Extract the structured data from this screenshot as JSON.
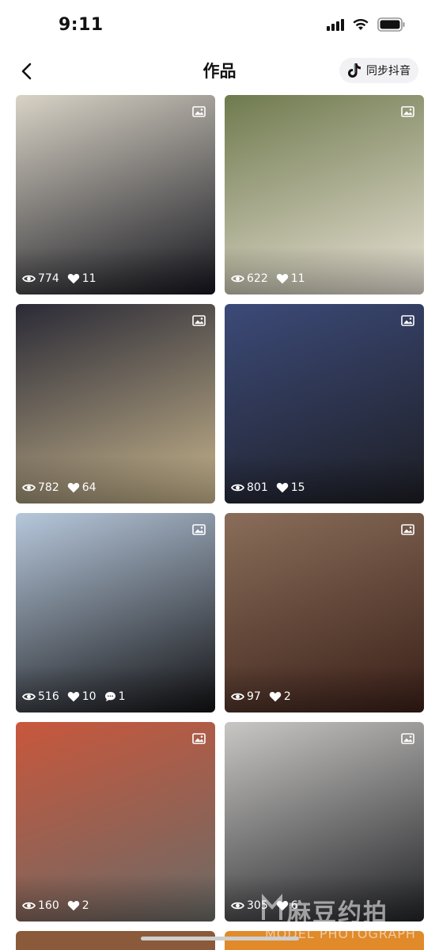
{
  "status_bar": {
    "time": "9:11",
    "signal_icon": "cellular-signal-icon",
    "wifi_icon": "wifi-icon",
    "battery_icon": "battery-icon"
  },
  "nav": {
    "back_icon": "chevron-left-icon",
    "title": "作品",
    "sync_button_label": "同步抖音",
    "sync_icon": "tiktok-logo-icon"
  },
  "posts": [
    {
      "views": "774",
      "likes": "11",
      "comments": null,
      "colors": [
        "#d9d3c6",
        "#15161e"
      ]
    },
    {
      "views": "622",
      "likes": "11",
      "comments": null,
      "colors": [
        "#6f7a4e",
        "#e9e2d6"
      ]
    },
    {
      "views": "782",
      "likes": "64",
      "comments": null,
      "colors": [
        "#2a2a36",
        "#c7b48c"
      ]
    },
    {
      "views": "801",
      "likes": "15",
      "comments": null,
      "colors": [
        "#3c4a78",
        "#1d1e24"
      ]
    },
    {
      "views": "516",
      "likes": "10",
      "comments": "1",
      "colors": [
        "#b7c8dc",
        "#121214"
      ]
    },
    {
      "views": "97",
      "likes": "2",
      "comments": null,
      "colors": [
        "#8a6e5a",
        "#3a1f18"
      ]
    },
    {
      "views": "160",
      "likes": "2",
      "comments": null,
      "colors": [
        "#c8573c",
        "#6a6a66"
      ]
    },
    {
      "views": "305",
      "likes": "6",
      "comments": null,
      "colors": [
        "#c9c7c4",
        "#222327"
      ]
    }
  ],
  "partial_row_colors": [
    "#8a5a3a",
    "#e08a2a"
  ],
  "icons": {
    "image_badge": "image-icon",
    "views": "eye-icon",
    "likes": "heart-icon",
    "comments": "comment-icon"
  },
  "watermark": {
    "text": "麻豆约拍",
    "subtext": "MODEL PHOTOGRAPH"
  }
}
